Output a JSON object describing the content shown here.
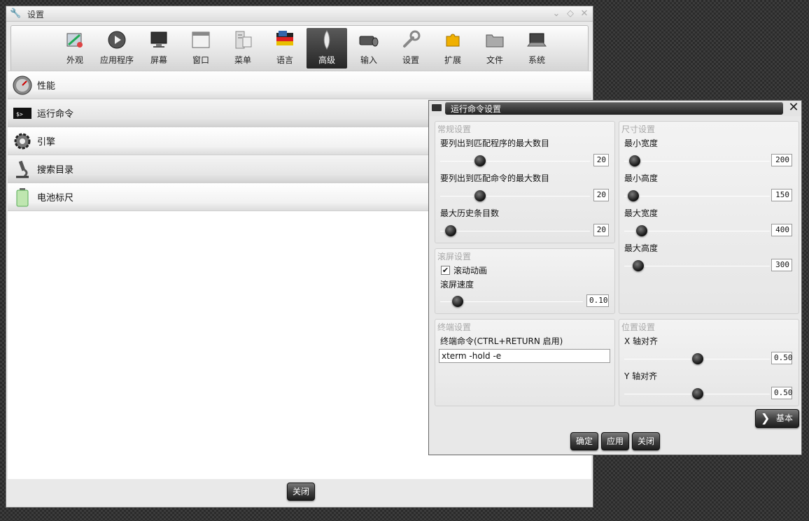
{
  "window": {
    "title": "设置"
  },
  "toolbar": {
    "items": [
      {
        "label": "外观",
        "icon": "appearance-icon"
      },
      {
        "label": "应用程序",
        "icon": "applications-icon"
      },
      {
        "label": "屏幕",
        "icon": "screen-icon"
      },
      {
        "label": "窗口",
        "icon": "window-icon"
      },
      {
        "label": "菜单",
        "icon": "menu-icon"
      },
      {
        "label": "语言",
        "icon": "language-icon"
      },
      {
        "label": "高级",
        "icon": "advanced-icon"
      },
      {
        "label": "输入",
        "icon": "input-icon"
      },
      {
        "label": "设置",
        "icon": "settings-icon"
      },
      {
        "label": "扩展",
        "icon": "extensions-icon"
      },
      {
        "label": "文件",
        "icon": "files-icon"
      },
      {
        "label": "系统",
        "icon": "system-icon"
      }
    ],
    "active": "高级"
  },
  "list": {
    "items": [
      {
        "label": "性能",
        "icon": "performance-icon"
      },
      {
        "label": "运行命令",
        "icon": "terminal-icon"
      },
      {
        "label": "引擎",
        "icon": "engine-icon"
      },
      {
        "label": "搜索目录",
        "icon": "microscope-icon"
      },
      {
        "label": "电池标尺",
        "icon": "battery-icon"
      }
    ]
  },
  "main": {
    "close_label": "关闭"
  },
  "dialog": {
    "title": "运行命令设置",
    "general": {
      "title": "常规设置",
      "max_apps_label": "要列出到匹配程序的最大数目",
      "max_apps_value": "20",
      "max_apps_level": 0.2,
      "max_cmds_label": "要列出到匹配命令的最大数目",
      "max_cmds_value": "20",
      "max_cmds_level": 0.2,
      "max_history_label": "最大历史条目数",
      "max_history_value": "20",
      "max_history_level": 0.05
    },
    "scroll": {
      "title": "滚屏设置",
      "animate_label": "滚动动画",
      "animate_checked": true,
      "speed_label": "滚屏速度",
      "speed_value": "0.10",
      "speed_level": 0.1
    },
    "terminal": {
      "title": "终端设置",
      "command_label": "终端命令(CTRL+RETURN 启用)",
      "command_value": "xterm -hold -e"
    },
    "size": {
      "title": "尺寸设置",
      "min_width_label": "最小宽度",
      "min_width_value": "200",
      "min_height_label": "最小高度",
      "min_height_value": "150",
      "max_width_label": "最大宽度",
      "max_width_value": "400",
      "max_height_label": "最大高度",
      "max_height_value": "300"
    },
    "position": {
      "title": "位置设置",
      "x_align_label": "X 轴对齐",
      "x_align_value": "0.50",
      "y_align_label": "Y 轴对齐",
      "y_align_value": "0.50"
    },
    "basic_label": "基本",
    "ok_label": "确定",
    "apply_label": "应用",
    "close_label": "关闭"
  }
}
